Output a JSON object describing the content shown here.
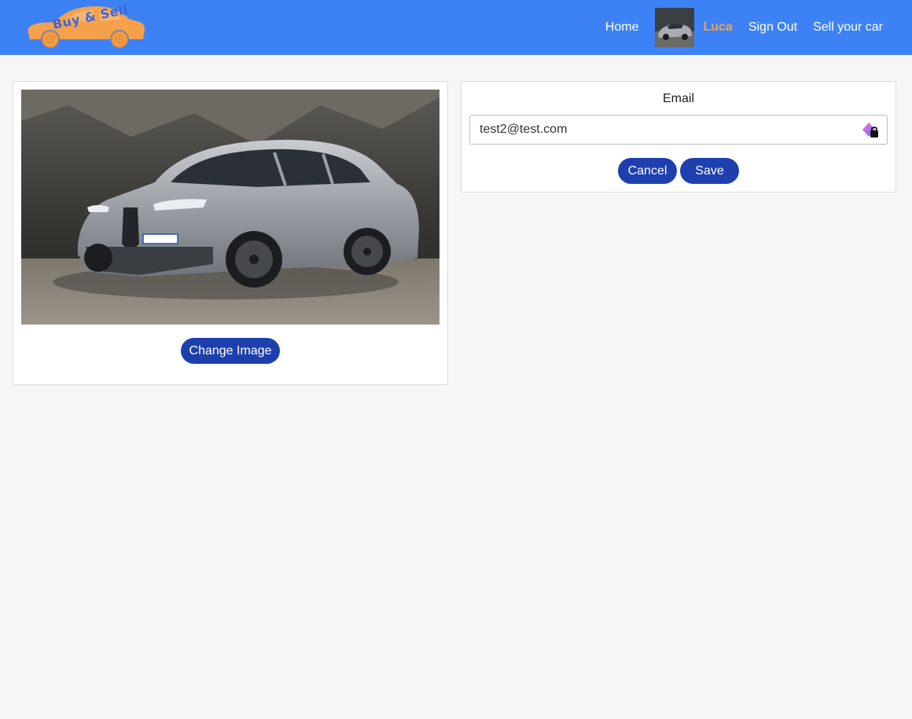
{
  "header": {
    "logo_text": "Buy & Sell",
    "nav": {
      "home": "Home",
      "user_name": "Luca",
      "sign_out": "Sign Out",
      "sell": "Sell your car"
    }
  },
  "profile": {
    "change_image_label": "Change Image",
    "email_label": "Email",
    "email_value": "test2@test.com",
    "cancel_label": "Cancel",
    "save_label": "Save"
  },
  "icons": {
    "logo": "car-logo-icon",
    "avatar": "user-avatar-image",
    "password_manager": "password-manager-lock-icon"
  },
  "colors": {
    "navbar": "#3d82f5",
    "logo_car": "#f5a04a",
    "logo_text": "#3d66d8",
    "username": "#f5a04a",
    "button": "#1e40af",
    "page_bg": "#f6f6f6"
  }
}
